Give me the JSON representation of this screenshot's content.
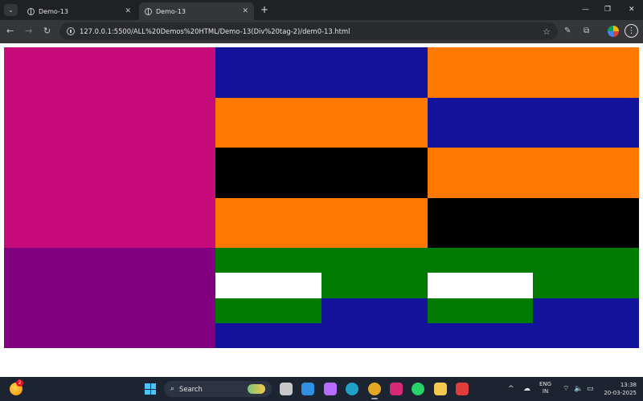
{
  "browser": {
    "tabs": [
      {
        "title": "Demo-13",
        "active": false
      },
      {
        "title": "Demo-13",
        "active": true
      }
    ],
    "new_tab_glyph": "+",
    "tab_search_glyph": "⌄",
    "tab_close_glyph": "✕",
    "window_controls": {
      "minimize": "—",
      "restore": "❐",
      "close": "✕"
    },
    "nav": {
      "back": "←",
      "forward": "→",
      "reload": "↻"
    },
    "url": "127.0.0.1:5500/ALL%20Demos%20HTML/Demo-13(Div%20tag-2)/dem0-13.html",
    "bookmark_glyph": "☆",
    "extension_glyphs": {
      "pen": "✎",
      "puzzle": "⧉"
    },
    "menu_glyph": "⋮",
    "icons": [
      "tab-search-icon",
      "globe-icon",
      "close-icon",
      "plus-icon",
      "minimize-icon",
      "restore-icon",
      "back-arrow-icon",
      "forward-arrow-icon",
      "reload-icon",
      "site-info-icon",
      "star-icon",
      "pen-icon",
      "puzzle-icon",
      "profile-icon",
      "kebab-menu-icon"
    ]
  },
  "page": {
    "colors": {
      "magenta": "#c70b7a",
      "purple": "#800080",
      "navy": "#12129a",
      "orange": "#ff7800",
      "black": "#000000",
      "green": "#007a00",
      "white": "#ffffff"
    },
    "grid": {
      "columns": 6,
      "rows": 12,
      "blocks": [
        {
          "name": "magenta-block",
          "color": "magenta",
          "col": 0,
          "row": 0,
          "colspan": 2,
          "rowspan": 8
        },
        {
          "name": "purple-block",
          "color": "purple",
          "col": 0,
          "row": 8,
          "colspan": 2,
          "rowspan": 4
        },
        {
          "name": "navy-block-1",
          "color": "navy",
          "col": 2,
          "row": 0,
          "colspan": 2,
          "rowspan": 2
        },
        {
          "name": "orange-block-1",
          "color": "orange",
          "col": 4,
          "row": 0,
          "colspan": 2,
          "rowspan": 2
        },
        {
          "name": "orange-block-2",
          "color": "orange",
          "col": 2,
          "row": 2,
          "colspan": 2,
          "rowspan": 2
        },
        {
          "name": "navy-block-2",
          "color": "navy",
          "col": 4,
          "row": 2,
          "colspan": 2,
          "rowspan": 2
        },
        {
          "name": "black-block-1",
          "color": "black",
          "col": 2,
          "row": 4,
          "colspan": 2,
          "rowspan": 2
        },
        {
          "name": "orange-block-3",
          "color": "orange",
          "col": 4,
          "row": 4,
          "colspan": 2,
          "rowspan": 2
        },
        {
          "name": "orange-block-4",
          "color": "orange",
          "col": 2,
          "row": 6,
          "colspan": 2,
          "rowspan": 2
        },
        {
          "name": "black-block-2",
          "color": "black",
          "col": 4,
          "row": 6,
          "colspan": 2,
          "rowspan": 2
        },
        {
          "name": "green-band",
          "color": "green",
          "col": 2,
          "row": 8,
          "colspan": 4,
          "rowspan": 1
        },
        {
          "name": "white-block-1",
          "color": "white",
          "col": 2,
          "row": 9,
          "colspan": 1,
          "rowspan": 1
        },
        {
          "name": "green-block-1",
          "color": "green",
          "col": 3,
          "row": 9,
          "colspan": 1,
          "rowspan": 1
        },
        {
          "name": "white-block-2",
          "color": "white",
          "col": 4,
          "row": 9,
          "colspan": 1,
          "rowspan": 1
        },
        {
          "name": "green-block-2",
          "color": "green",
          "col": 5,
          "row": 9,
          "colspan": 1,
          "rowspan": 1
        },
        {
          "name": "green-block-3",
          "color": "green",
          "col": 2,
          "row": 10,
          "colspan": 1,
          "rowspan": 1
        },
        {
          "name": "navy-block-3",
          "color": "navy",
          "col": 3,
          "row": 10,
          "colspan": 1,
          "rowspan": 1
        },
        {
          "name": "green-block-4",
          "color": "green",
          "col": 4,
          "row": 10,
          "colspan": 1,
          "rowspan": 1
        },
        {
          "name": "navy-block-4",
          "color": "navy",
          "col": 5,
          "row": 10,
          "colspan": 1,
          "rowspan": 1
        },
        {
          "name": "navy-band",
          "color": "navy",
          "col": 2,
          "row": 11,
          "colspan": 4,
          "rowspan": 1
        }
      ]
    }
  },
  "taskbar": {
    "weather_badge": "2",
    "search_placeholder": "Search",
    "search_glyph": "⌕",
    "apps": [
      {
        "name": "task-view-icon",
        "color": "#c8c8c8"
      },
      {
        "name": "vscode-icon",
        "color": "#2f8fe0"
      },
      {
        "name": "copilot-icon",
        "color": "#b86bff"
      },
      {
        "name": "edge-icon",
        "color": "#1fa0c8"
      },
      {
        "name": "chrome-icon",
        "color": "#e2a925"
      },
      {
        "name": "instagram-icon",
        "color": "#d62976"
      },
      {
        "name": "whatsapp-icon",
        "color": "#25d366"
      },
      {
        "name": "file-explorer-icon",
        "color": "#f2c94c"
      },
      {
        "name": "screen-recorder-icon",
        "color": "#e23b3b"
      }
    ],
    "tray": {
      "chevron": "^",
      "cloud": "☁",
      "wifi": "⌔",
      "volume": "🔈",
      "battery": "▭"
    },
    "language": {
      "line1": "ENG",
      "line2": "IN"
    },
    "clock": {
      "time": "13:38",
      "date": "20-03-2025"
    }
  }
}
